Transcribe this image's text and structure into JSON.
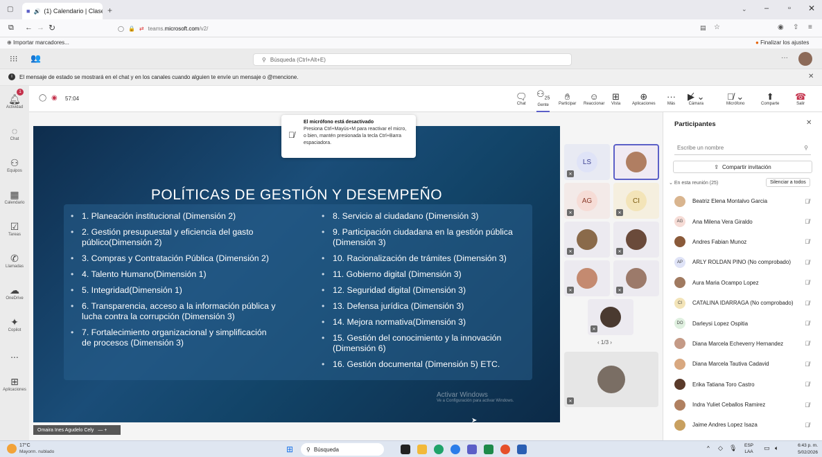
{
  "browser": {
    "tab_title": "(1) Calendario | Clase 2 | M ×",
    "url_host": "teams.",
    "url_domain": "microsoft.com",
    "url_path": "/v2/",
    "bookmark": "Importar marcadores...",
    "finish_settings": "Finalizar los ajustes"
  },
  "teams": {
    "search_placeholder": "Búsqueda (Ctrl+Alt+E)",
    "status_notice": "El mensaje de estado se mostrará en el chat y en los canales cuando alguien te envíe un mensaje o @mencione.",
    "rail": [
      "Actividad",
      "Chat",
      "Equipos",
      "Calendario",
      "Tareas",
      "Llamadas",
      "OneDrive",
      "Copilot",
      "...",
      "Aplicaciones"
    ],
    "activity_badge": "1"
  },
  "meeting": {
    "timer": "57:04",
    "controls": {
      "chat": "Chat",
      "people": "Gente",
      "people_count": "25",
      "raise": "Participar",
      "react": "Reaccionar",
      "view": "Vista",
      "apps": "Aplicaciones",
      "more": "Más",
      "camera": "Cámara",
      "mic": "Micrófono",
      "share": "Comparte",
      "leave": "Salir"
    },
    "toast": {
      "title": "El micrófono está desactivado",
      "body": "Presiona Ctrl+Mayús+M para reactivar el micro, o bien, mantén presionada la tecla Ctrl+Barra espaciadora."
    },
    "speaker_name": "Omaira Ines Agudelo Cely",
    "gallery_pager": "1/3",
    "gallery_initials": [
      "LS",
      "AG",
      "CI"
    ]
  },
  "slide": {
    "title": "POLÍTICAS DE GESTIÓN Y DESEMPEÑO",
    "left": [
      "1. Planeación institucional (Dimensión 2)",
      "2. Gestión presupuestal y eficiencia del gasto público(Dimensión 2)",
      "3. Compras y Contratación Pública (Dimensión 2)",
      "4. Talento Humano(Dimensión 1)",
      "5. Integridad(Dimensión 1)",
      "6. Transparencia, acceso a la información pública y lucha contra la corrupción (Dimensión 3)",
      "7. Fortalecimiento organizacional y simplificación de procesos (Dimensión 3)"
    ],
    "right": [
      "8. Servicio al ciudadano (Dimensión 3)",
      "9. Participación ciudadana en la gestión pública (Dimensión 3)",
      "10. Racionalización de trámites (Dimensión 3)",
      "11. Gobierno digital (Dimensión 3)",
      "12. Seguridad digital (Dimensión 3)",
      "13. Defensa jurídica (Dimensión 3)",
      "14. Mejora normativa(Dimensión 3)",
      "15. Gestión del conocimiento y la innovación (Dimensión 6)",
      "16. Gestión documental (Dimensión 5) ETC."
    ],
    "watermark_title": "Activar Windows",
    "watermark_sub": "Ve a Configuración para activar Windows."
  },
  "participants": {
    "title": "Participantes",
    "search_placeholder": "Escribe un nombre",
    "invite": "Compartir invitación",
    "section": "En esta reunión (25)",
    "mute_all": "Silenciar a todos",
    "list": [
      {
        "name": "Beatriz Elena Montalvo Garcia",
        "initials": ""
      },
      {
        "name": "Ana Milena Vera Giraldo",
        "initials": "AG"
      },
      {
        "name": "Andres Fabian Munoz",
        "initials": ""
      },
      {
        "name": "ARLY ROLDAN PINO (No comprobado)",
        "initials": "AP"
      },
      {
        "name": "Aura Maria Ocampo Lopez",
        "initials": ""
      },
      {
        "name": "CATALINA IDARRAGA (No comprobado)",
        "initials": "CI"
      },
      {
        "name": "Darleysi Lopez Ospitia",
        "initials": "DO"
      },
      {
        "name": "Diana Marcela Echeverry Hernandez",
        "initials": ""
      },
      {
        "name": "Diana Marcela Tautiva Cadavid",
        "initials": ""
      },
      {
        "name": "Erika Tatiana Toro Castro",
        "initials": ""
      },
      {
        "name": "Indra Yuliet Ceballos Ramirez",
        "initials": ""
      },
      {
        "name": "Jaime Andres Lopez Isaza",
        "initials": ""
      }
    ]
  },
  "taskbar": {
    "weather_temp": "17°C",
    "weather_desc": "Mayorm. nublado",
    "search": "Búsqueda",
    "lang": "ESP",
    "lang_sub": "LAA",
    "time": "6:43 p. m.",
    "date": "5/02/2026"
  }
}
